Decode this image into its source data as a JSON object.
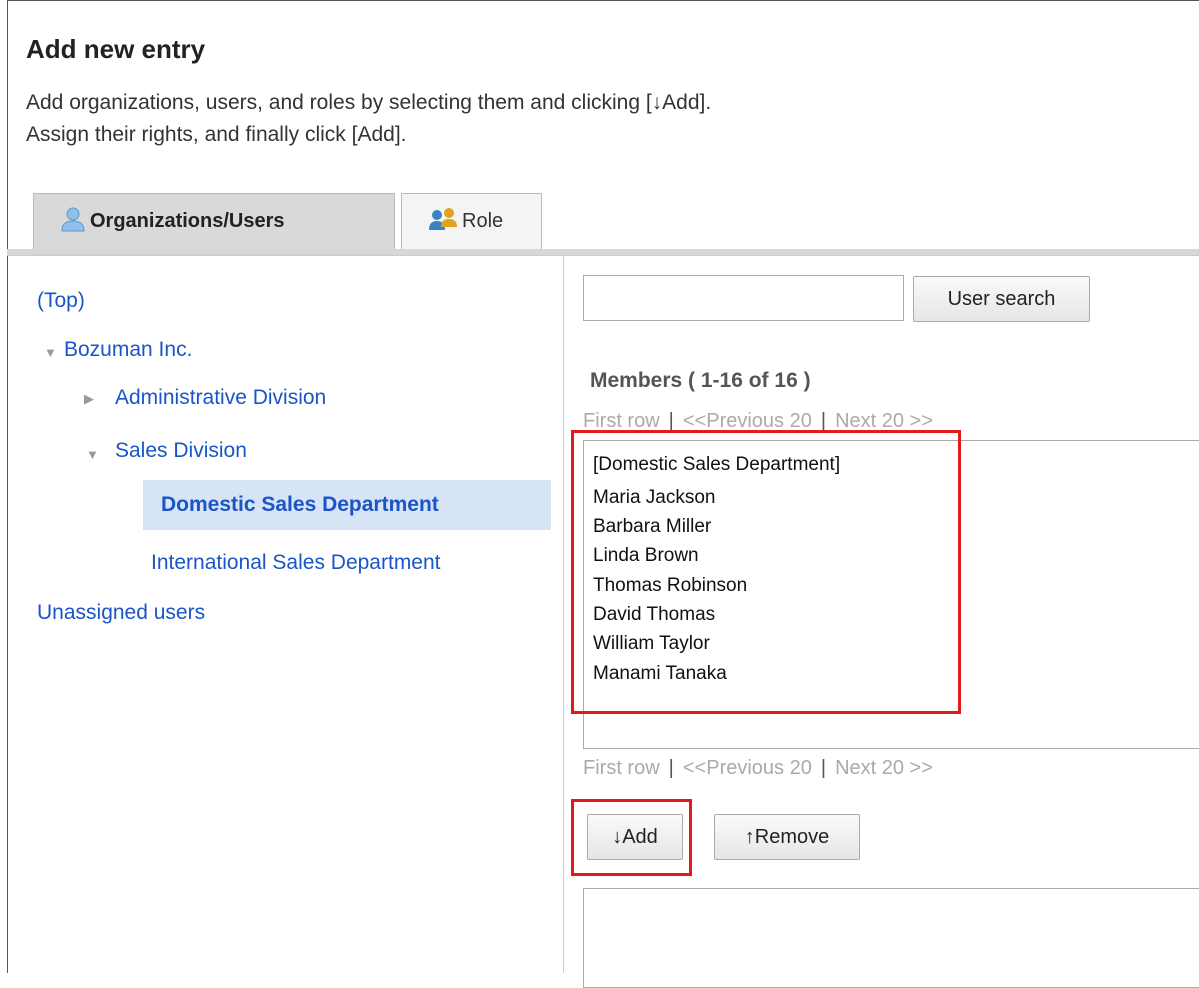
{
  "header": {
    "title": "Add new entry",
    "desc_line1": "Add organizations, users, and roles by selecting them and clicking [↓Add].",
    "desc_line2": "Assign their rights, and finally click [Add]."
  },
  "tabs": [
    {
      "label": "Organizations/Users",
      "icon": "user-icon",
      "active": true
    },
    {
      "label": "Role",
      "icon": "role-icon",
      "active": false
    }
  ],
  "tree": {
    "top": "(Top)",
    "company": "Bozuman Inc.",
    "admin_division": "Administrative Division",
    "sales_division": "Sales Division",
    "domestic_sales": "Domestic Sales Department",
    "international_sales": "International Sales Department",
    "unassigned": "Unassigned users"
  },
  "search": {
    "value": "",
    "button_label": "User search"
  },
  "members": {
    "title": "Members ( 1-16 of 16 )",
    "pager": {
      "first": "First row",
      "sep": "|",
      "previous": "<<Previous 20",
      "next": "Next 20 >>"
    },
    "items": [
      "[Domestic Sales Department]",
      "Maria Jackson",
      "Barbara Miller",
      "Linda Brown",
      "Thomas Robinson",
      "David Thomas",
      "William Taylor",
      "Manami Tanaka"
    ]
  },
  "actions": {
    "add_label": "↓Add",
    "remove_label": "↑Remove"
  },
  "colors": {
    "link": "#1a55c8",
    "highlight": "#e41a1a",
    "selected_bg": "#d6e4f5"
  }
}
